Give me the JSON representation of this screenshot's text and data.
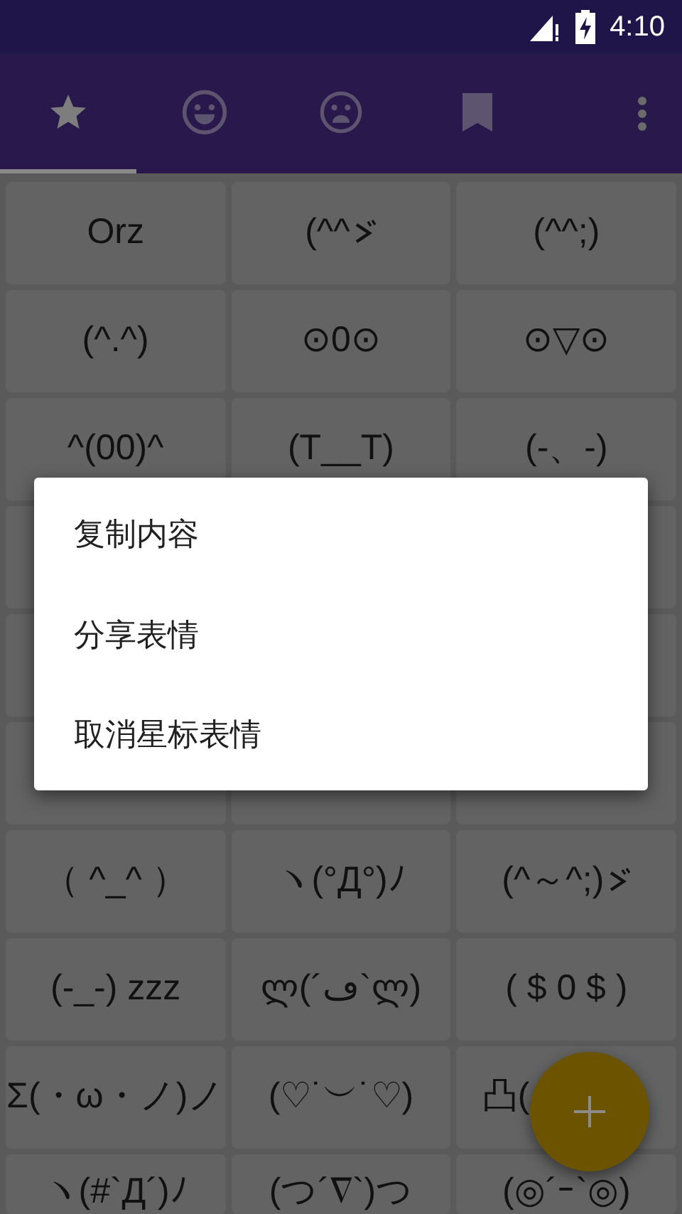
{
  "status_bar": {
    "time": "4:10"
  },
  "tabs": [
    {
      "selected": true
    },
    {
      "selected": false
    },
    {
      "selected": false
    },
    {
      "selected": false
    }
  ],
  "grid": {
    "rows_above": [
      [
        "Orz",
        {
          "text": "(^^",
          "kind": "iteration-mark"
        },
        "(^^;)"
      ],
      [
        "(^.^)",
        "⊙0⊙",
        "⊙▽⊙"
      ],
      [
        "^(00)^",
        "(T__T)",
        "(-、-)"
      ]
    ],
    "rows_below": [
      [
        "（ ^_^ ）",
        "ヽ(°Д°)ﾉ",
        {
          "text": "(^～^;)",
          "kind": "iteration-mark"
        }
      ],
      [
        "(-_-) zzz",
        "ლ(´ڡ`ლ)",
        "( $ 0 $ )"
      ],
      [
        "Σ(・ω・ノ)ノ",
        "(♡˙︶˙♡)",
        "凸("
      ],
      [
        "ヽ(#`Д´)ﾉ",
        "(つ´∇`)つ",
        "(◎´ｰ`◎)"
      ]
    ]
  },
  "menu": {
    "items": [
      "复制内容",
      "分享表情",
      "取消星标表情"
    ]
  }
}
